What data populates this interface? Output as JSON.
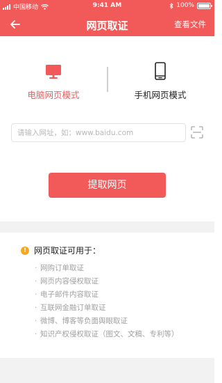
{
  "status_bar": {
    "carrier": "中国移动",
    "time": "9:41 AM",
    "battery": "100%"
  },
  "nav": {
    "title": "网页取证",
    "right_action": "查看文件",
    "back_icon": "arrow-left-icon"
  },
  "modes": {
    "desktop_label": "电脑网页模式",
    "mobile_label": "手机网页模式",
    "selected": "desktop"
  },
  "url_input": {
    "value": "",
    "placeholder": "请输入网址，如：www.baidu.com"
  },
  "fetch_button_label": "提取网页",
  "uses": {
    "title": "网页取证可用于：",
    "items": [
      "网购订单取证",
      "网页内容侵权取证",
      "电子邮件内容取证",
      "互联网金融订单取证",
      "微博、博客等负面舆眼取证",
      "知识产权侵权取证（图文、文稿、专利等）"
    ]
  },
  "colors": {
    "accent": "#f25a5a",
    "info": "#f5a623",
    "muted_text": "#a0a0a0",
    "band": "#f2f2f2"
  }
}
